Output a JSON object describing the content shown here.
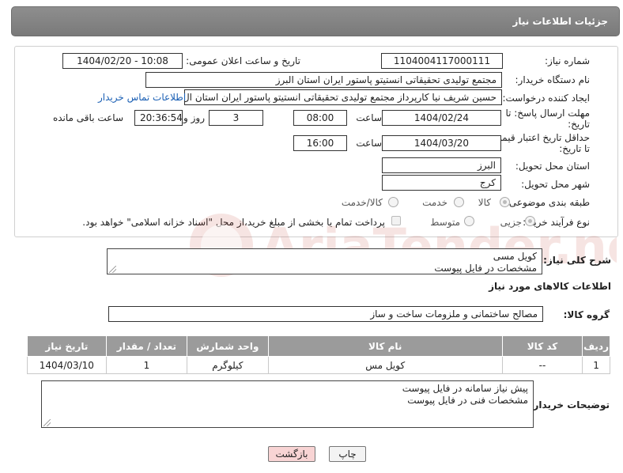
{
  "header": {
    "title": "جزئیات اطلاعات نیاز"
  },
  "form": {
    "need_number": {
      "label": "شماره نیاز:",
      "value": "1104004117000111"
    },
    "announce_datetime": {
      "label": "تاریخ و ساعت اعلان عمومی:",
      "value": "1404/02/20 - 10:08"
    },
    "buyer_org": {
      "label": "نام دستگاه خریدار:",
      "value": "مجتمع تولیدی تحقیقاتی انستیتو پاستور ایران استان البرز"
    },
    "requester": {
      "label": "ایجاد کننده درخواست:",
      "value": "حسین شریف نیا کارپرداز مجتمع تولیدی تحقیقاتی انستیتو پاستور ایران استان ال",
      "contact_link": "اطلاعات تماس خریدار"
    },
    "reply_deadline": {
      "label_line1": "مهلت ارسال پاسخ: تا",
      "label_line2": "تاریخ:",
      "date": "1404/02/24",
      "time_label": "ساعت",
      "time": "08:00",
      "days": "3",
      "days_label": "روز و",
      "remaining": "20:36:54",
      "remaining_label": "ساعت باقی مانده"
    },
    "price_validity": {
      "label_line1": "حداقل تاریخ اعتبار قیمت:",
      "label_line2": "تا تاریخ:",
      "date": "1404/03/20",
      "time_label": "ساعت",
      "time": "16:00"
    },
    "delivery_province": {
      "label": "استان محل تحویل:",
      "value": "البرز"
    },
    "delivery_city": {
      "label": "شهر محل تحویل:",
      "value": "کرج"
    },
    "category": {
      "label": "طبقه بندی موضوعی:",
      "options": [
        "کالا",
        "خدمت",
        "کالا/خدمت"
      ],
      "selected": "کالا"
    },
    "process_type": {
      "label": "نوع فرآیند خرید :",
      "options": [
        "جزیی",
        "متوسط"
      ],
      "selected": "جزیی",
      "payment_note": "پرداخت تمام یا بخشی از مبلغ خرید،از محل \"اسناد خزانه اسلامی\" خواهد بود."
    }
  },
  "need_summary": {
    "label": "شرح کلی نیاز:",
    "lines": [
      "کویل مسی",
      "مشخصات در فایل پیوست"
    ]
  },
  "goods_section": {
    "title": "اطلاعات کالاهای مورد نیاز"
  },
  "goods_group": {
    "label": "گروه کالا:",
    "value": "مصالح ساختمانی و ملزومات ساخت و ساز"
  },
  "items_table": {
    "headers": [
      "ردیف",
      "کد کالا",
      "نام کالا",
      "واحد شمارش",
      "تعداد / مقدار",
      "تاریخ نیاز"
    ],
    "rows": [
      [
        "1",
        "--",
        "کویل مس",
        "کیلوگرم",
        "1",
        "1404/03/10"
      ]
    ]
  },
  "buyer_notes": {
    "label": "توضیحات خریدار:",
    "lines": [
      "پیش نیاز سامانه در فایل پیوست",
      "مشخصات فنی در فایل پیوست"
    ]
  },
  "buttons": {
    "print": "چاپ",
    "back": "بازگشت"
  },
  "watermark": {
    "text": "AriaTender.neT"
  },
  "colors": {
    "header_bg": "#828282",
    "link": "#1a5fb4",
    "table_header": "#9b9b9b",
    "back_button": "#f8d4d4"
  }
}
